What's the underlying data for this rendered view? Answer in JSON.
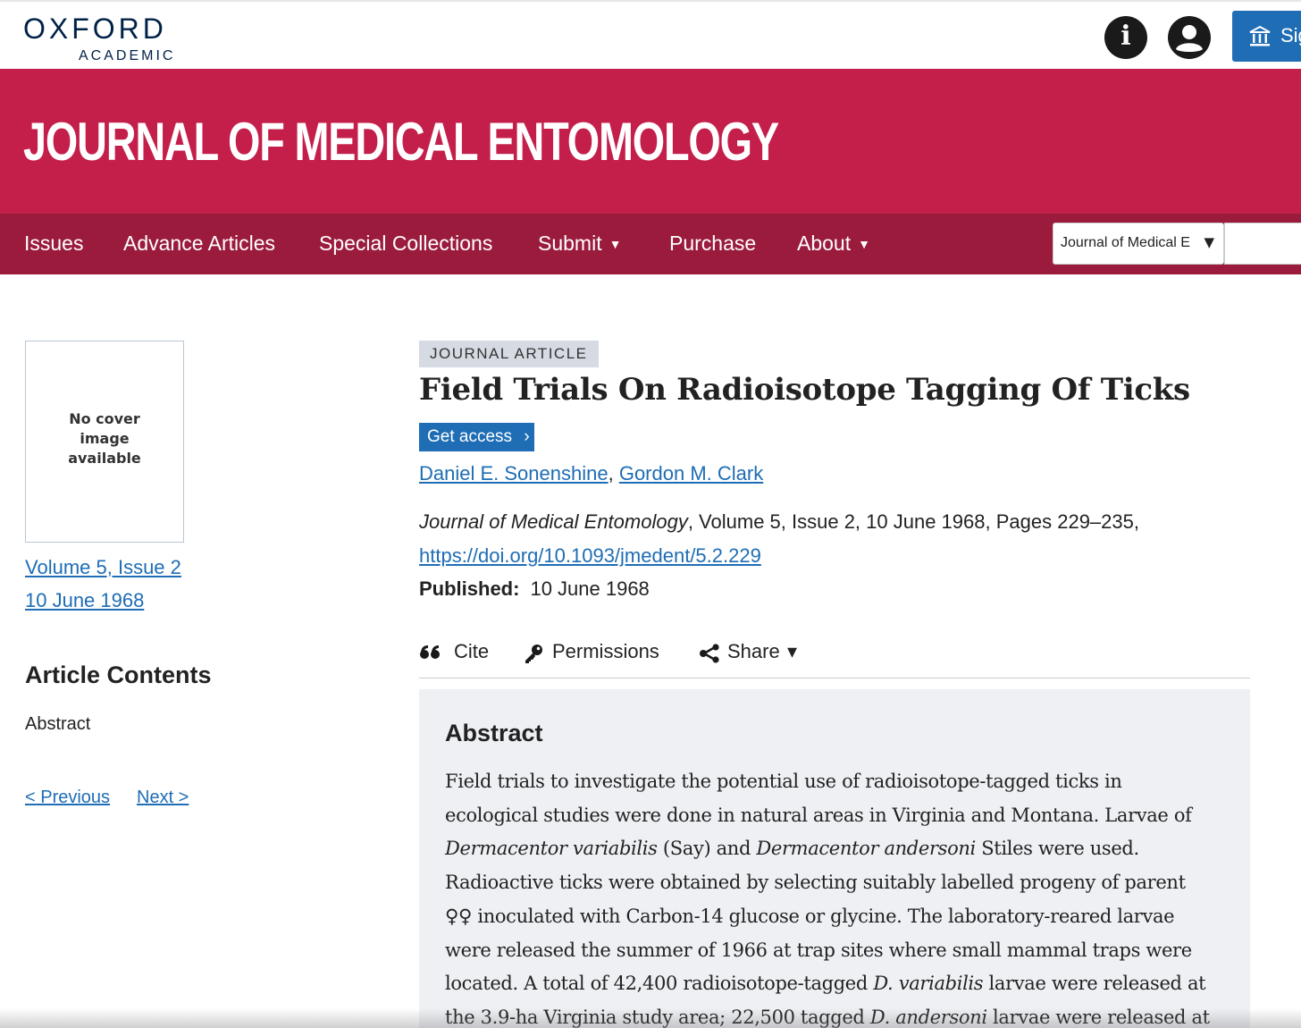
{
  "header": {
    "logo_main": "OXFORD",
    "logo_sub": "ACADEMIC",
    "info_icon": "info-icon",
    "user_icon": "user-account-icon",
    "signin_label": "Sig",
    "signin_icon": "institution-icon"
  },
  "banner": {
    "journal_title": "JOURNAL OF MEDICAL ENTOMOLOGY",
    "color": "#c41f4b"
  },
  "nav": {
    "color": "#9b1b3d",
    "items": [
      {
        "label": "Issues",
        "has_dropdown": false
      },
      {
        "label": "Advance Articles",
        "has_dropdown": false
      },
      {
        "label": "Special Collections",
        "has_dropdown": false
      },
      {
        "label": "Submit",
        "has_dropdown": true
      },
      {
        "label": "Purchase",
        "has_dropdown": false
      },
      {
        "label": "About",
        "has_dropdown": true
      }
    ],
    "caret": "▼",
    "search_scope_value": "Journal of Medical E",
    "search_scope_arrow": "▼"
  },
  "sidebar": {
    "cover_text": [
      "No cover",
      "image",
      "available"
    ],
    "volume_link": "Volume 5, Issue 2",
    "date_link": "10 June 1968",
    "contents_heading": "Article Contents",
    "contents_items": [
      "Abstract"
    ],
    "prev_link": "< Previous",
    "next_link": "Next >"
  },
  "article": {
    "type_badge": "JOURNAL ARTICLE",
    "title": "Field Trials On Radioisotope Tagging Of Ticks",
    "access_button": "Get access",
    "access_chevron": "›",
    "authors": [
      "Daniel E. Sonenshine",
      "Gordon M. Clark"
    ],
    "author_sep": ", ",
    "journal_name": "Journal of Medical Entomology",
    "citation_rest": ", Volume 5, Issue 2, 10 June 1968, Pages 229–235,",
    "doi": "https://doi.org/10.1093/jmedent/5.2.229",
    "published_label": "Published:",
    "published_date": "10 June 1968",
    "tools": {
      "cite": "Cite",
      "permissions": "Permissions",
      "share": "Share",
      "share_caret": "▾"
    }
  },
  "abstract": {
    "heading": "Abstract",
    "lines": [
      [
        {
          "t": "Field trials to investigate the potential use of radioisotope-tagged ticks in"
        }
      ],
      [
        {
          "t": "ecological studies were done in natural areas in Virginia and Montana. Larvae of"
        }
      ],
      [
        {
          "t": "Dermacentor variabilis",
          "i": true
        },
        {
          "t": " (Say) and "
        },
        {
          "t": "Dermacentor andersoni",
          "i": true
        },
        {
          "t": " Stiles were used."
        }
      ],
      [
        {
          "t": "Radioactive ticks were obtained by selecting suitably labelled progeny of parent"
        }
      ],
      [
        {
          "t": "♀♀ inoculated with Carbon-14 glucose or glycine. The laboratory-reared larvae"
        }
      ],
      [
        {
          "t": "were released the summer of 1966 at trap sites where small mammal traps were"
        }
      ],
      [
        {
          "t": "located. A total of 42,400 radioisotope-tagged "
        },
        {
          "t": "D. variabilis",
          "i": true
        },
        {
          "t": " larvae were released at"
        }
      ],
      [
        {
          "t": "the 3.9-ha Virginia study area; 22,500 tagged "
        },
        {
          "t": "D. andersoni",
          "i": true
        },
        {
          "t": " larvae were released at"
        }
      ]
    ]
  }
}
